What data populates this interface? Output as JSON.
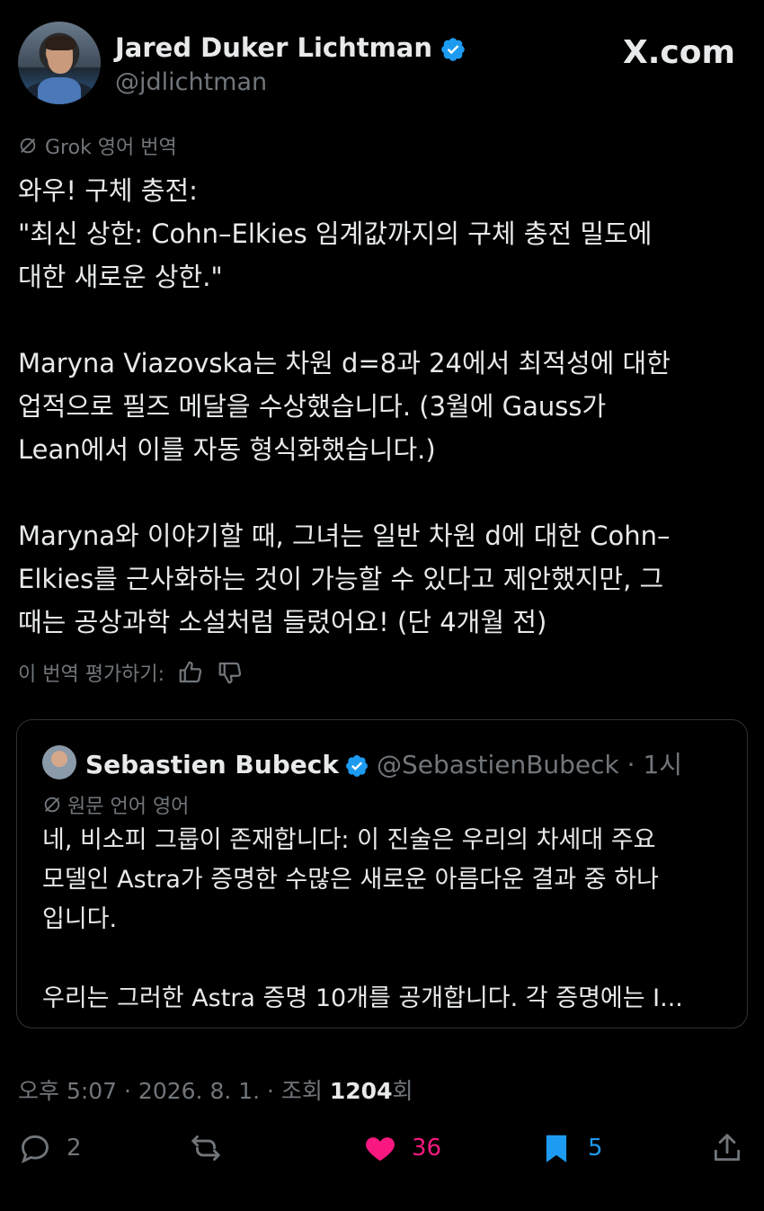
{
  "author": {
    "name": "Jared Duker Lichtman",
    "handle": "@jdlichtman",
    "verified": true
  },
  "site": "X.com",
  "translation_note": "Grok 영어 번역",
  "body": {
    "lines_p1": [
      "와우! 구체 충전:",
      "\"최신 상한: Cohn–Elkies 임계값까지의 구체 충전 밀도에",
      "대한 새로운 상한.\""
    ],
    "lines_p2": [
      "Maryna Viazovska는 차원 d=8과 24에서 최적성에 대한",
      "업적으로 필즈 메달을 수상했습니다. (3월에 Gauss가",
      "Lean에서 이를 자동 형식화했습니다.)"
    ],
    "lines_p3": [
      "Maryna와 이야기할 때, 그녀는 일반 차원 d에 대한 Cohn–",
      "Elkies를 근사화하는 것이 가능할 수 있다고 제안했지만, 그",
      "때는 공상과학 소설처럼 들렸어요! (단 4개월 전)"
    ]
  },
  "rate_translation": "이 번역 평가하기:",
  "quote": {
    "name": "Sebastien Bubeck",
    "handle": "@SebastienBubeck · 1시",
    "verified": true,
    "note": "원문 언어 영어",
    "lines_p1": [
      "네, 비소피 그룹이 존재합니다: 이 진술은 우리의 차세대 주요",
      "모델인 Astra가 증명한 수많은 새로운 아름다운 결과 중 하나",
      "입니다."
    ],
    "lines_p2": [
      "우리는 그러한 Astra 증명 10개를 공개합니다. 각 증명에는 I..."
    ]
  },
  "meta": {
    "time": "오후 5:07 · 2026. 8. 1. · 조회 ",
    "views": "1204",
    "views_suffix": "회"
  },
  "actions": {
    "replies": "2",
    "retweets": "",
    "likes": "36",
    "bookmarks": "5"
  },
  "colors": {
    "background": "#000000",
    "text": "#e7e9ea",
    "muted": "#71767b",
    "verified": "#1d9bf0",
    "like": "#f91880",
    "bookmark": "#1d9bf0"
  }
}
